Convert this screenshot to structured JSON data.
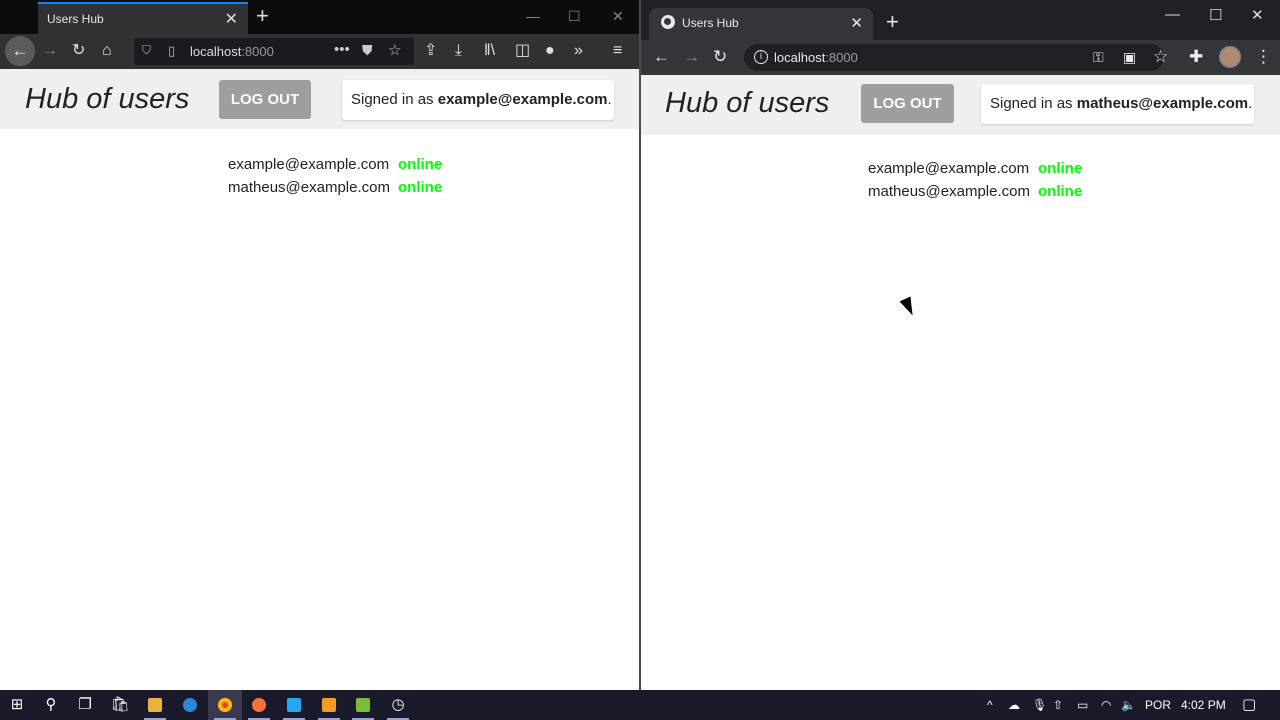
{
  "left_browser": {
    "tab_title": "Users Hub",
    "url_host": "localhost",
    "url_port": ":8000",
    "app": {
      "title": "Hub of users",
      "logout_label": "LOG OUT",
      "signed_in_prefix": "Signed in as ",
      "signed_in_email": "example@example.com",
      "signed_in_suffix": ".",
      "users": [
        {
          "email": "example@example.com",
          "status": "online"
        },
        {
          "email": "matheus@example.com",
          "status": "online"
        }
      ]
    }
  },
  "right_browser": {
    "tab_title": "Users Hub",
    "url_host": "localhost",
    "url_port": ":8000",
    "app": {
      "title": "Hub of users",
      "logout_label": "LOG OUT",
      "signed_in_prefix": "Signed in as ",
      "signed_in_email": "matheus@example.com",
      "signed_in_suffix": ".",
      "users": [
        {
          "email": "example@example.com",
          "status": "online"
        },
        {
          "email": "matheus@example.com",
          "status": "online"
        }
      ]
    }
  },
  "taskbar": {
    "language": "POR",
    "time": "4:02 PM"
  },
  "colors": {
    "online": "#00ff00",
    "logout_bg": "#9e9e9e",
    "header_bg": "#efefef",
    "firefox_accent": "#0a84ff"
  },
  "icons": [
    "start-icon",
    "search-icon",
    "task-view-icon",
    "store-icon",
    "file-explorer-icon",
    "edge-icon",
    "chrome-icon",
    "firefox-icon",
    "vscode-icon",
    "sublime-icon",
    "excel-icon",
    "clock-app-icon",
    "chevron-up-icon",
    "onedrive-icon",
    "microphone-icon",
    "upload-icon",
    "battery-icon",
    "wifi-icon",
    "volume-icon",
    "notification-icon"
  ]
}
